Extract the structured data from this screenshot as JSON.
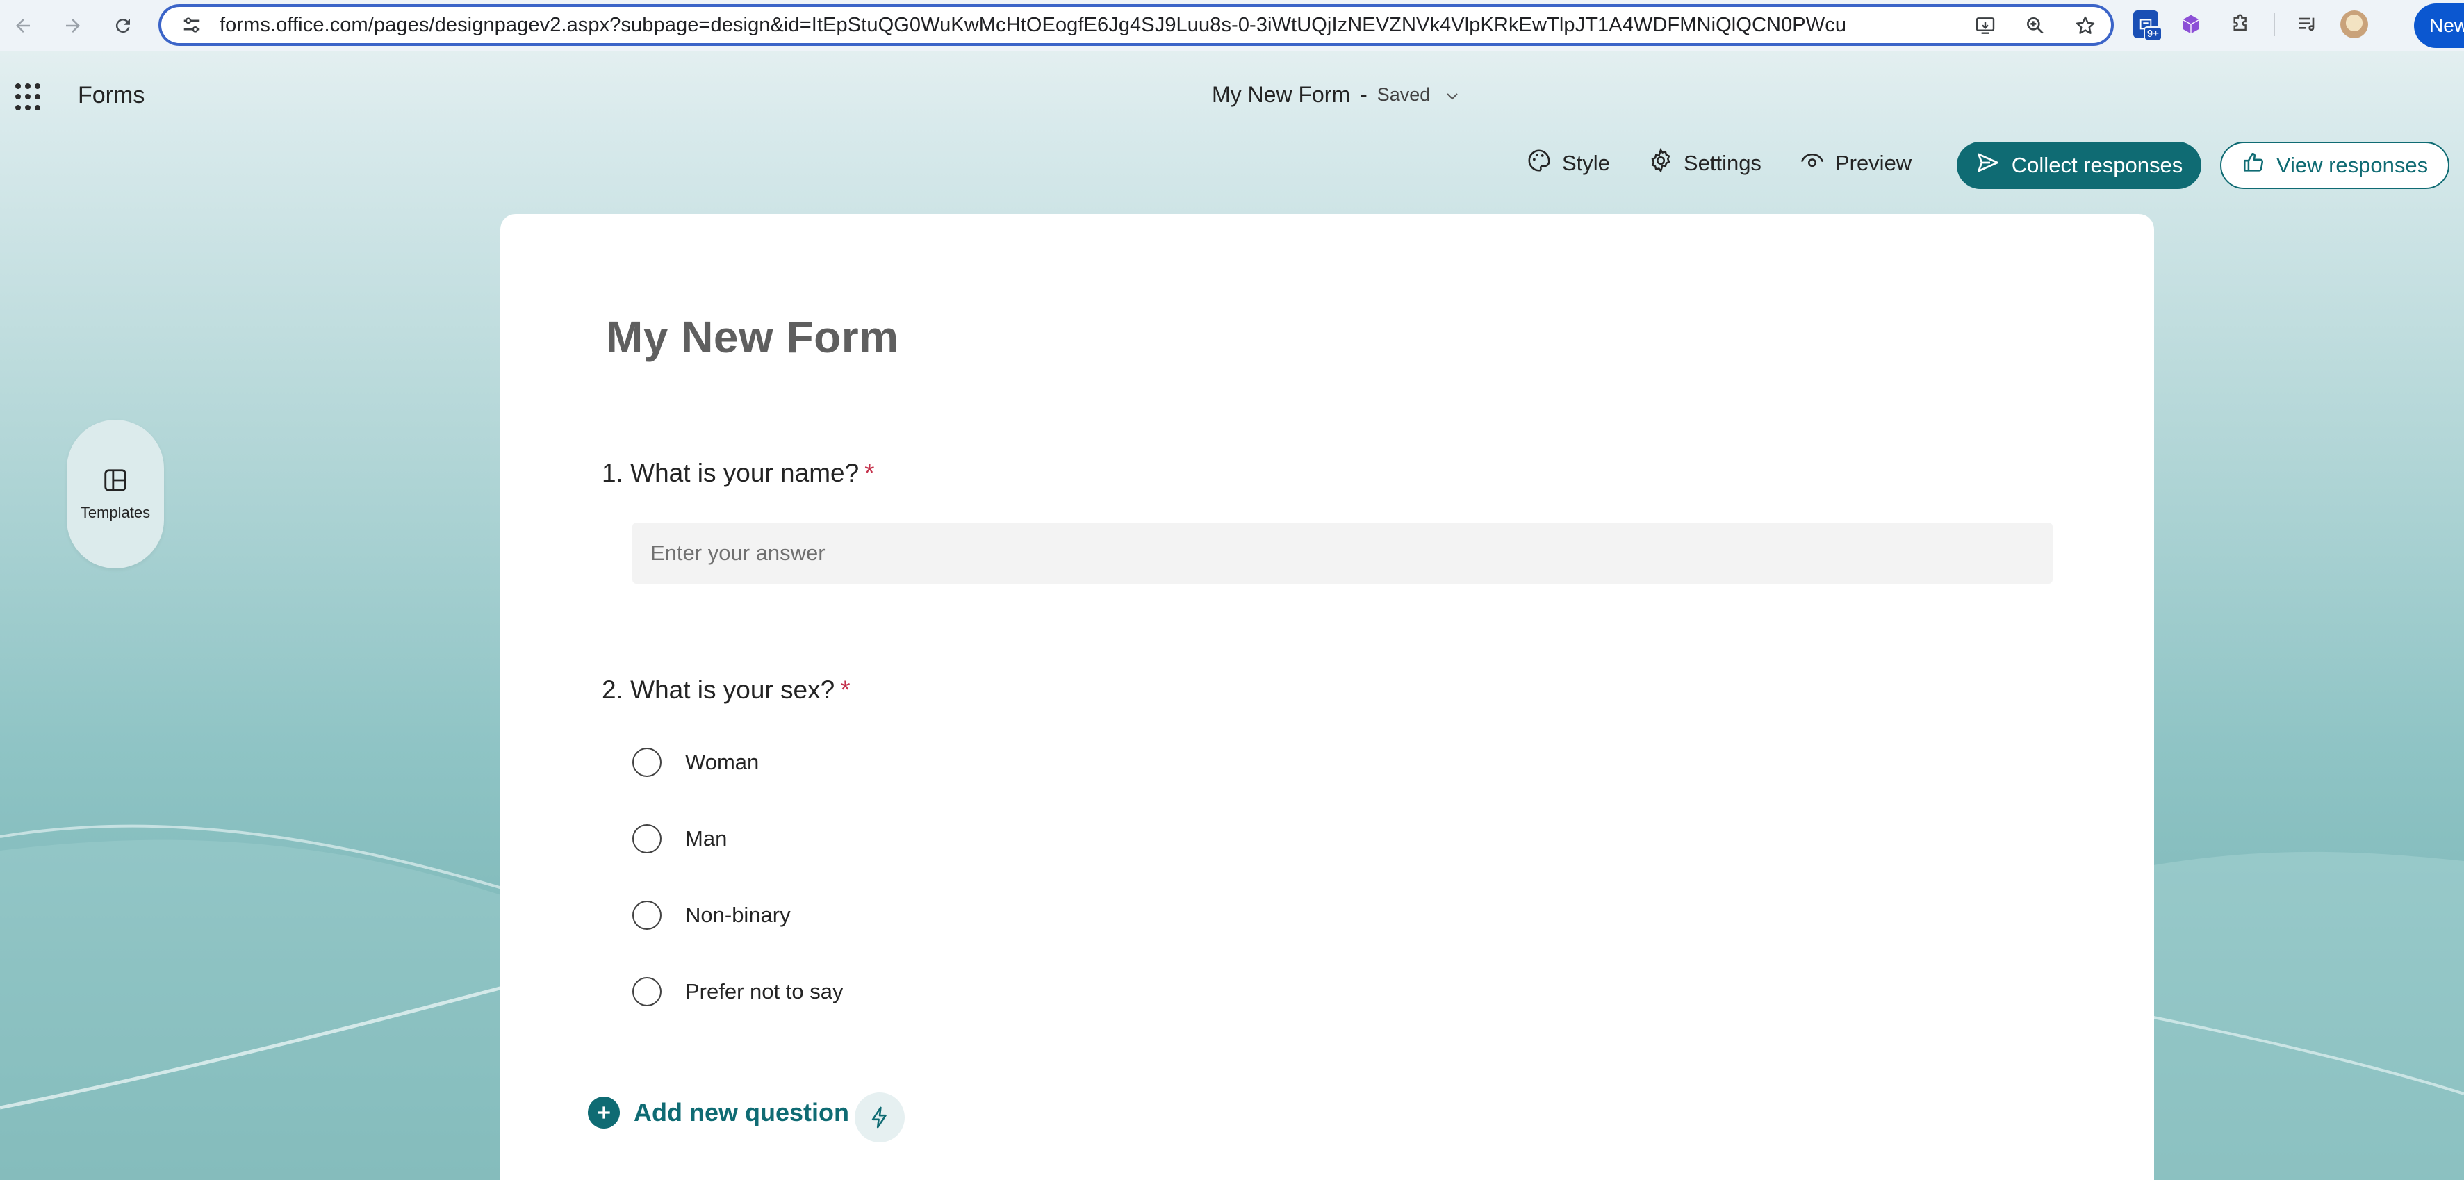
{
  "browser": {
    "url": "forms.office.com/pages/designpagev2.aspx?subpage=design&id=ItEpStuQG0WuKwMcHtOEogfE6Jg4SJ9Luu8s-0-3iWtUQjIzNEVZNVk4VlpKRkEwTlpJT1A4WDFMNiQlQCN0PWcu",
    "new_button_label": "New",
    "extension_badge": "9+",
    "icons": [
      "back-icon",
      "forward-icon",
      "reload-icon",
      "site-info-icon",
      "install-icon",
      "zoom-icon",
      "star-icon",
      "extension-icon",
      "puzzle-icon",
      "media-icon",
      "profile-avatar"
    ]
  },
  "header": {
    "app_name": "Forms",
    "form_title": "My New Form",
    "separator": "-",
    "save_status": "Saved"
  },
  "toolbar": {
    "style_label": "Style",
    "settings_label": "Settings",
    "preview_label": "Preview",
    "collect_label": "Collect responses",
    "view_label": "View responses"
  },
  "side": {
    "templates_label": "Templates"
  },
  "form": {
    "title": "My New Form",
    "questions": [
      {
        "number": "1.",
        "text": "What is your name?",
        "required_mark": "*",
        "placeholder": "Enter your answer"
      },
      {
        "number": "2.",
        "text": "What is your sex?",
        "required_mark": "*",
        "options": [
          "Woman",
          "Man",
          "Non-binary",
          "Prefer not to say"
        ]
      }
    ],
    "add_question_label": "Add new question"
  },
  "colors": {
    "accent": "#0f6b73",
    "required": "#c4314b",
    "url_focus": "#3b64c8"
  }
}
